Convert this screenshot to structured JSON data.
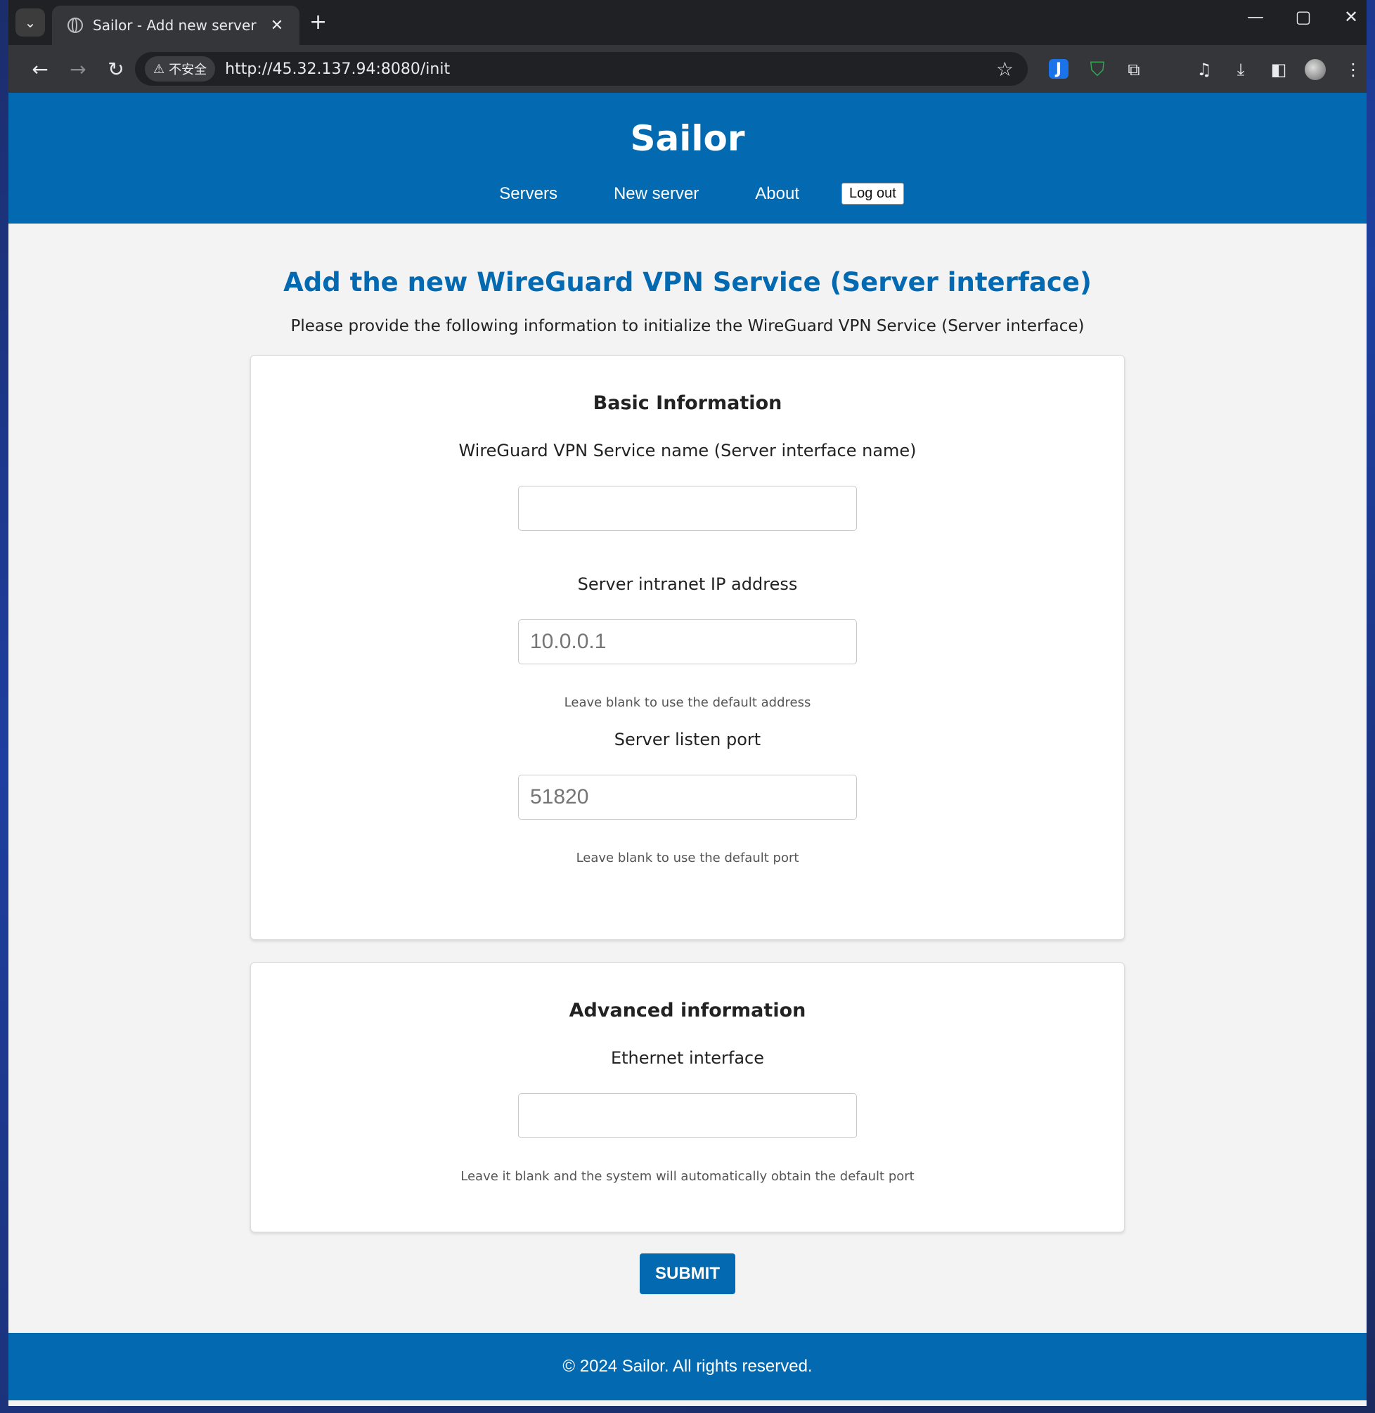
{
  "browser": {
    "tab_title": "Sailor - Add new server",
    "tab_close": "✕",
    "new_tab": "+",
    "security_label": "不安全",
    "url": "http://45.32.137.94:8080/init"
  },
  "header": {
    "brand": "Sailor",
    "nav": {
      "servers": "Servers",
      "new_server": "New server",
      "about": "About",
      "logout": "Log out"
    }
  },
  "main": {
    "title": "Add the new WireGuard VPN Service (Server interface)",
    "intro": "Please provide the following information to initialize the WireGuard VPN Service (Server interface)",
    "basic": {
      "heading": "Basic Information",
      "service_name_label": "WireGuard VPN Service name (Server interface name)",
      "service_name_value": "",
      "ip_label": "Server intranet IP address",
      "ip_placeholder": "10.0.0.1",
      "ip_hint": "Leave blank to use the default address",
      "port_label": "Server listen port",
      "port_placeholder": "51820",
      "port_hint": "Leave blank to use the default port"
    },
    "advanced": {
      "heading": "Advanced information",
      "eth_label": "Ethernet interface",
      "eth_value": "",
      "eth_hint": "Leave it blank and the system will automatically obtain the default port"
    },
    "submit_label": "SUBMIT"
  },
  "footer": {
    "text": "© 2024 Sailor. All rights reserved."
  },
  "colors": {
    "brand_blue": "#0369b1",
    "browser_dark": "#202124",
    "toolbar": "#35363a"
  }
}
